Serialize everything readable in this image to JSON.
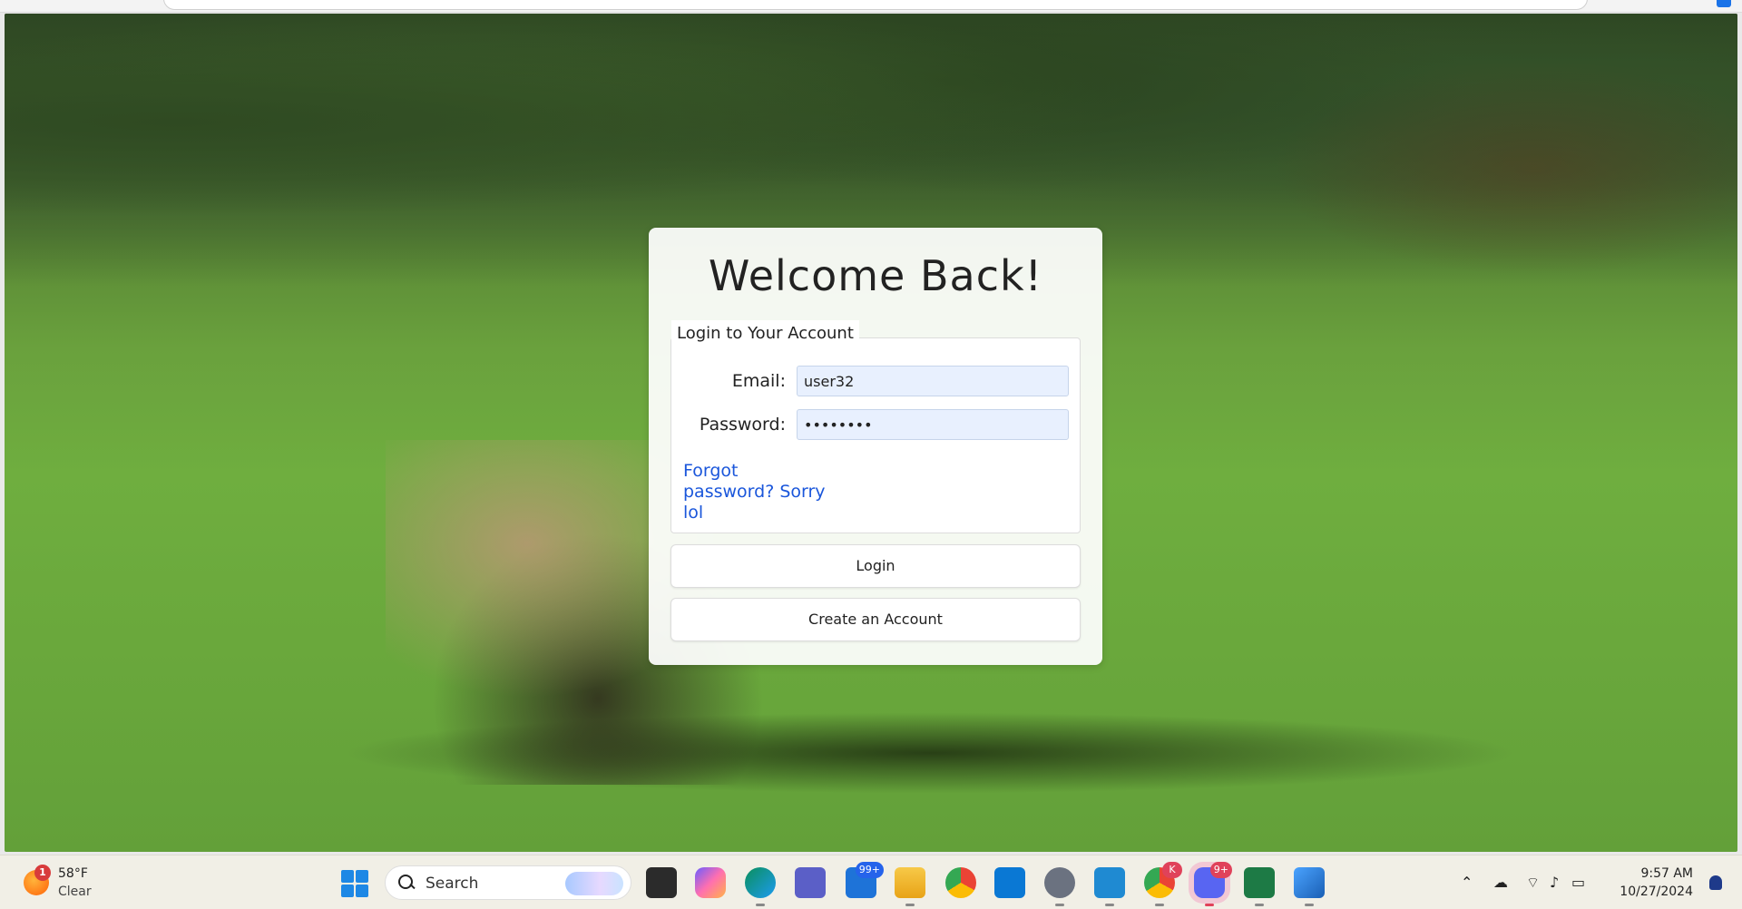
{
  "login": {
    "title": "Welcome Back!",
    "legend": "Login to Your Account",
    "email_label": "Email:",
    "email_value": "user32",
    "password_label": "Password:",
    "password_value": "••••••••",
    "forgot_link": "Forgot password? Sorry lol",
    "login_button": "Login",
    "create_button": "Create an Account"
  },
  "taskbar": {
    "weather_alert": "1",
    "temperature": "58°F",
    "condition": "Clear",
    "search_label": "Search",
    "mail_badge": "99+",
    "chrome_profile_badge": "K",
    "discord_badge": "9+",
    "time": "9:57 AM",
    "date": "10/27/2024"
  },
  "colors": {
    "link": "#1a56db",
    "input_bg": "#e8f0fe",
    "taskbar_bg": "#f1efe6"
  }
}
